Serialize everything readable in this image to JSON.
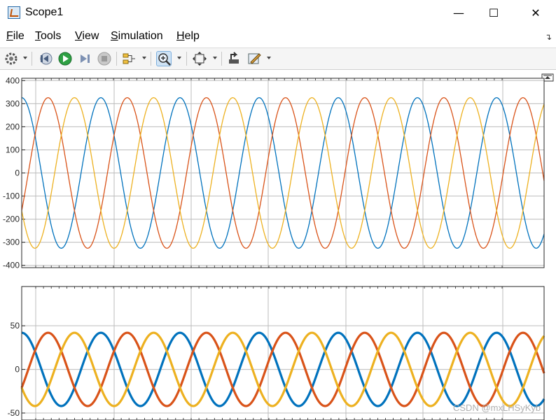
{
  "window": {
    "title": "Scope1",
    "minimize_glyph": "—",
    "maximize_glyph": "☐",
    "close_glyph": "✕"
  },
  "menu": {
    "items": [
      {
        "label": "File",
        "underline": "F",
        "rest": "ile"
      },
      {
        "label": "Tools",
        "underline": "T",
        "rest": "ools"
      },
      {
        "label": "View",
        "underline": "V",
        "rest": "iew"
      },
      {
        "label": "Simulation",
        "underline": "S",
        "rest": "imulation"
      },
      {
        "label": "Help",
        "underline": "H",
        "rest": "elp"
      }
    ]
  },
  "toolbar": {
    "icons": [
      "settings-gear-icon",
      "step-back-icon",
      "run-icon",
      "step-forward-icon",
      "stop-icon",
      "signal-selector-icon",
      "zoom-in-icon",
      "autoscale-icon",
      "highlight-simulink-block-icon",
      "style-icon"
    ]
  },
  "watermark": "CSDN @mxLHSyKyb",
  "colors": {
    "phase_a": "#0072BD",
    "phase_b": "#D95319",
    "phase_c": "#EDB120",
    "grid": "#bcbcbc",
    "axes_background": "#ffffff"
  },
  "chart_data": [
    {
      "type": "line",
      "title": "",
      "ylim": [
        -410,
        410
      ],
      "yticks": [
        400,
        300,
        200,
        100,
        0,
        -100,
        -200,
        -300,
        -400
      ],
      "amplitude": 326,
      "cycles_visible": 6.6,
      "grid": true,
      "series": [
        {
          "phase_deg": 90,
          "values_description_amplitude": 326
        },
        {
          "phase_deg": -30,
          "values_description_amplitude": 326
        },
        {
          "phase_deg": 210,
          "values_description_amplitude": 326
        }
      ]
    },
    {
      "type": "line",
      "title": "",
      "ylim": [
        -58,
        95
      ],
      "yticks": [
        50,
        0,
        -50
      ],
      "amplitude": 42,
      "cycles_visible": 6.6,
      "grid": true,
      "series": [
        {
          "phase_deg": 90,
          "values_description_amplitude": 42
        },
        {
          "phase_deg": -30,
          "values_description_amplitude": 42
        },
        {
          "phase_deg": 210,
          "values_description_amplitude": 42
        }
      ]
    }
  ]
}
